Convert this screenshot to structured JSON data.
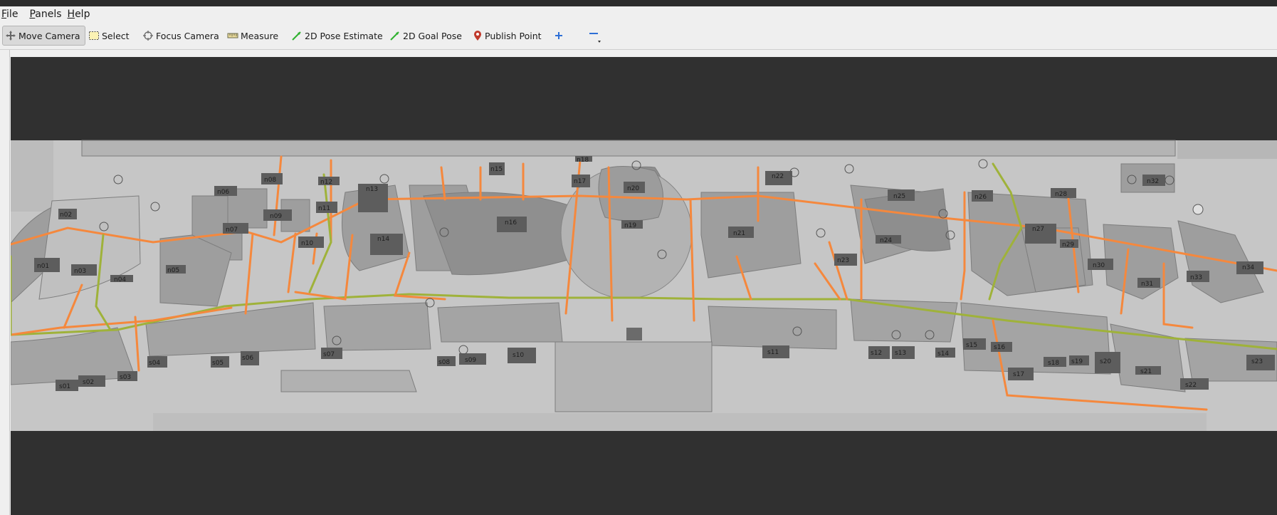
{
  "menu": {
    "items": [
      {
        "label": "File",
        "mnemonic": "F",
        "rest": "ile"
      },
      {
        "label": "Panels",
        "mnemonic": "P",
        "rest": "anels"
      },
      {
        "label": "Help",
        "mnemonic": "H",
        "rest": "elp"
      }
    ]
  },
  "toolbar": {
    "move_camera": "Move Camera",
    "select": "Select",
    "focus_camera": "Focus Camera",
    "measure": "Measure",
    "pose_estimate": "2D Pose Estimate",
    "goal_pose": "2D Goal Pose",
    "publish_point": "Publish Point",
    "active_tool": "Move Camera"
  },
  "colors": {
    "path_orange": "#f5883d",
    "path_green": "#9fb23a",
    "floor": "#c5c5c5",
    "store": "#8d8d8d",
    "label_box": "#5c5c5c",
    "viewport_bg": "#303030"
  },
  "map": {
    "stores_north": [
      "n01",
      "n02",
      "n03",
      "n04",
      "n05",
      "n06",
      "n07",
      "n08",
      "n09",
      "n10",
      "n11",
      "n12",
      "n13",
      "n14",
      "n15",
      "n16",
      "n17",
      "n18",
      "n19",
      "n20",
      "n21",
      "n22",
      "n23",
      "n24",
      "n25",
      "n26",
      "n27",
      "n28",
      "n29",
      "n30",
      "n31",
      "n32",
      "n33",
      "n34"
    ],
    "stores_south": [
      "s01",
      "s02",
      "s03",
      "s04",
      "s05",
      "s06",
      "s07",
      "s08",
      "s09",
      "s10",
      "s11",
      "s12",
      "s13",
      "s14",
      "s15",
      "s16",
      "s17",
      "s18",
      "s19",
      "s20",
      "s21",
      "s22",
      "s23"
    ]
  }
}
